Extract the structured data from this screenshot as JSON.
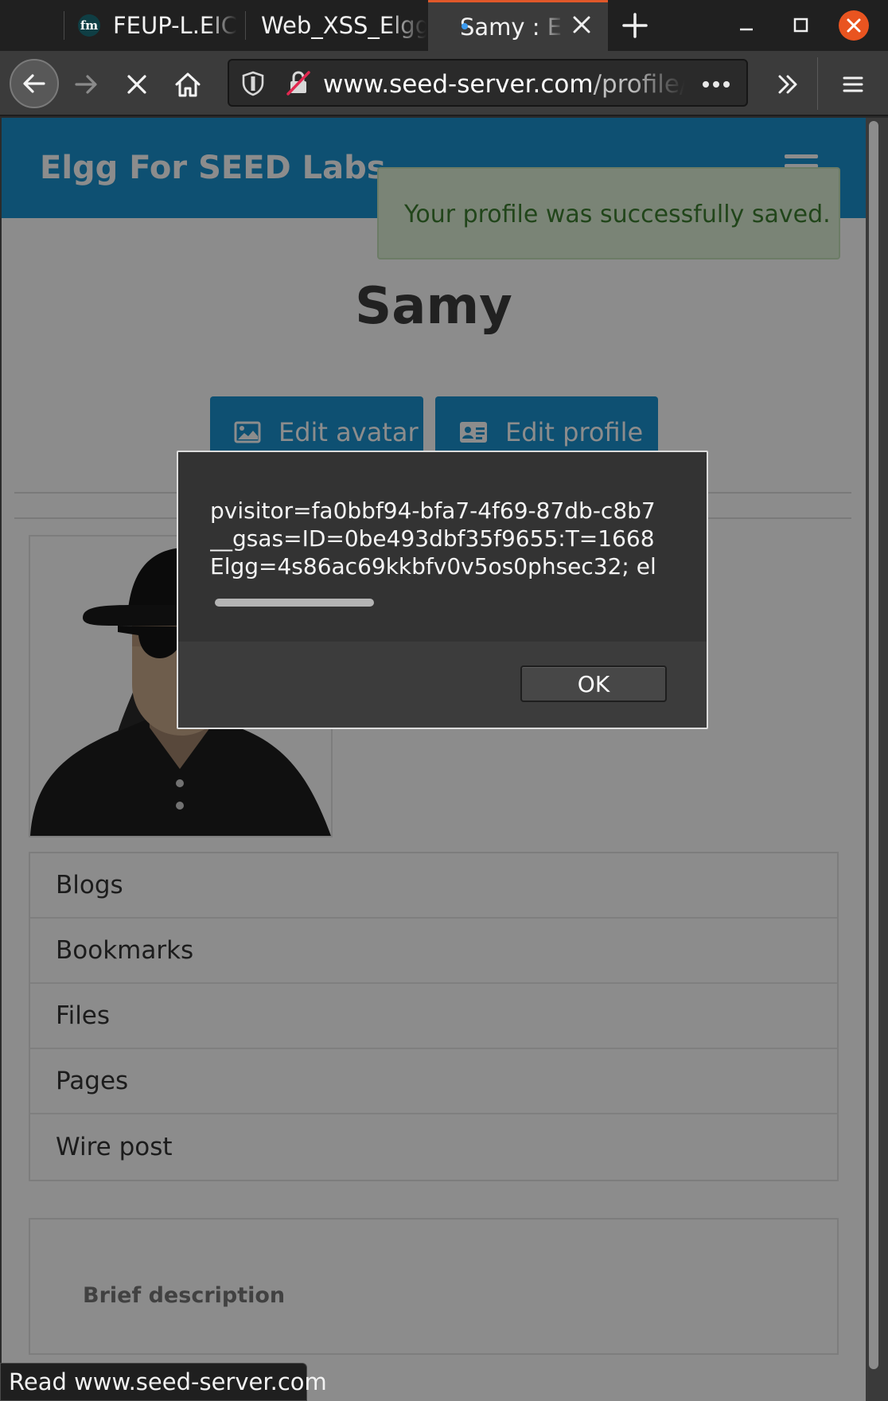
{
  "browser": {
    "tabs": [
      {
        "label": "FEUP-L.EIC",
        "favicon": "fm"
      },
      {
        "label": "Web_XSS_Elgg"
      },
      {
        "label": "Samy : Elgg",
        "active": true
      }
    ],
    "url_domain": "www.seed-server.com",
    "url_path": "/profile/samy",
    "status_text": "Read www.seed-server.com"
  },
  "site": {
    "title": "Elgg For SEED Labs",
    "alert": "Your profile was successfully saved.",
    "profile_name": "Samy",
    "buttons": {
      "edit_avatar": "Edit avatar",
      "edit_profile": "Edit profile"
    },
    "menu": [
      "Blogs",
      "Bookmarks",
      "Files",
      "Pages",
      "Wire post"
    ],
    "description_label": "Brief description"
  },
  "dialog": {
    "lines": [
      "pvisitor=fa0bbf94-bfa7-4f69-87db-c8b7",
      "__gsas=ID=0be493dbf35f9655:T=1668",
      "Elgg=4s86ac69kkbfv0v5os0phsec32; el"
    ],
    "ok_label": "OK"
  },
  "colors": {
    "brand_blue": "#1a92cf",
    "success_text": "#3c7e30",
    "close_orange": "#e95420",
    "tab_accent": "#e0582a"
  }
}
